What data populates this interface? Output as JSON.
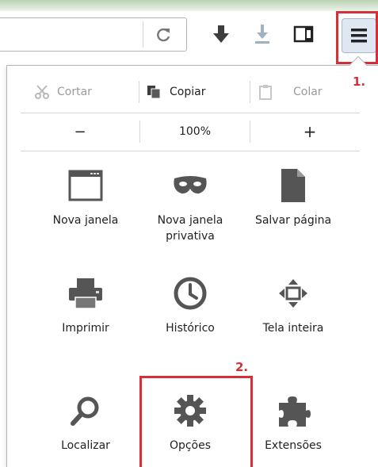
{
  "toolbar": {
    "reload_icon": "reload-icon",
    "downloads_icon": "download-icon",
    "save_to_pocket_icon": "download-tray-icon",
    "sidebar_icon": "sidebar-icon",
    "menu_icon": "hamburger-menu-icon"
  },
  "annotations": {
    "step1": "1.",
    "step2": "2.",
    "highlight_color": "#d62f3a"
  },
  "edit_controls": {
    "cut": "Cortar",
    "copy": "Copiar",
    "paste": "Colar"
  },
  "zoom_controls": {
    "zoom_out": "−",
    "zoom_level": "100%",
    "zoom_in": "+"
  },
  "menu_grid": [
    {
      "label": "Nova janela",
      "icon": "window-icon"
    },
    {
      "label": "Nova janela privativa",
      "icon": "mask-icon"
    },
    {
      "label": "Salvar página",
      "icon": "page-icon"
    },
    {
      "label": "Imprimir",
      "icon": "printer-icon"
    },
    {
      "label": "Histórico",
      "icon": "clock-icon"
    },
    {
      "label": "Tela inteira",
      "icon": "fullscreen-icon"
    },
    {
      "label": "Localizar",
      "icon": "magnifier-icon"
    },
    {
      "label": "Opções",
      "icon": "gear-icon"
    },
    {
      "label": "Extensões",
      "icon": "puzzle-icon"
    }
  ]
}
